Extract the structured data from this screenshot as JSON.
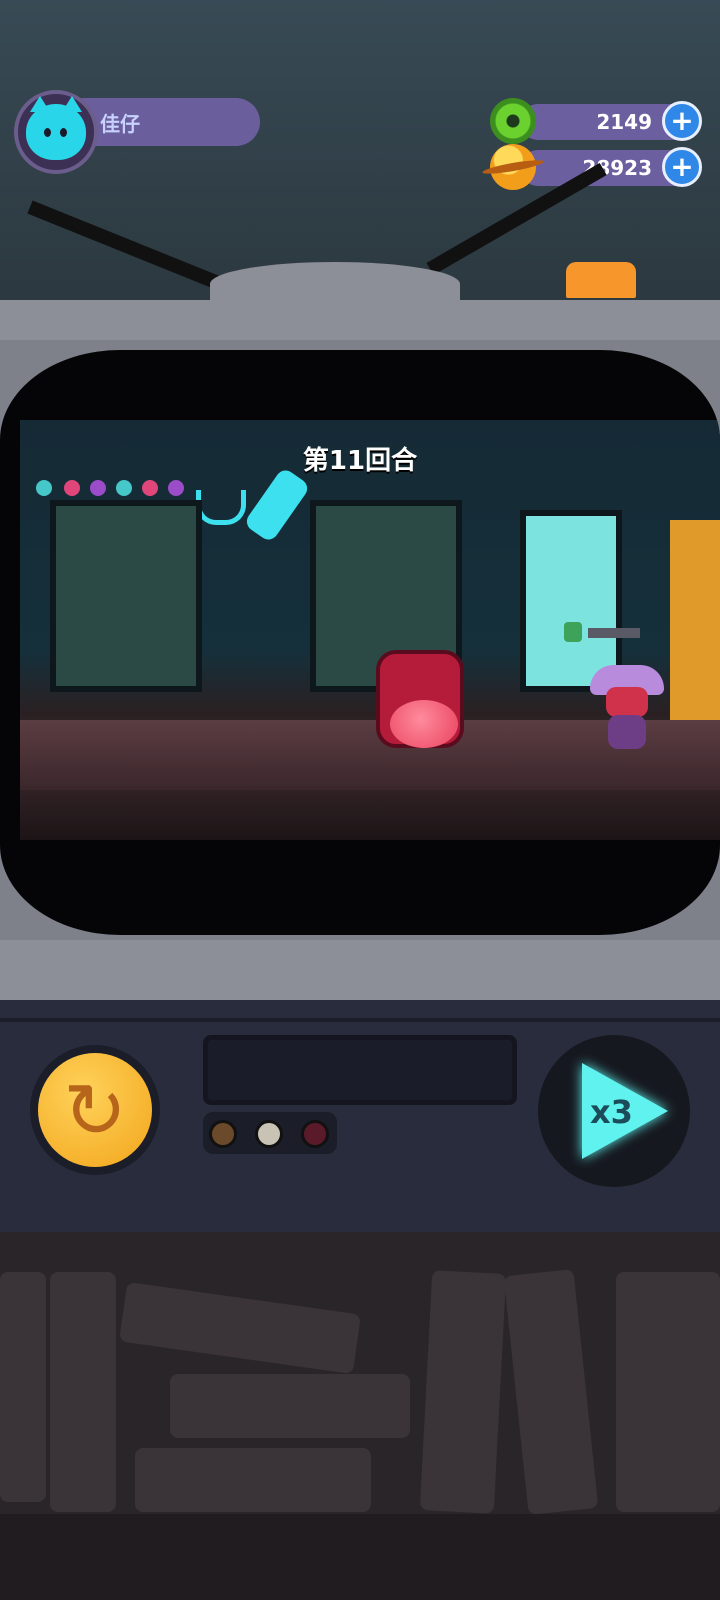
{
  "player": {
    "name": "佳仔"
  },
  "currencies": {
    "gems": {
      "value": "2149",
      "icon": "green-donut-icon"
    },
    "coins": {
      "value": "28923",
      "icon": "gold-planet-icon"
    }
  },
  "battle": {
    "round_label": "第11回合"
  },
  "controls": {
    "speed_label": "x3",
    "retry_icon": "↻"
  },
  "colors": {
    "accent_cyan": "#5ff2ee",
    "gold": "#f2a51b",
    "hud_purple": "#6c5fa0",
    "plus_blue": "#2f88e8"
  }
}
